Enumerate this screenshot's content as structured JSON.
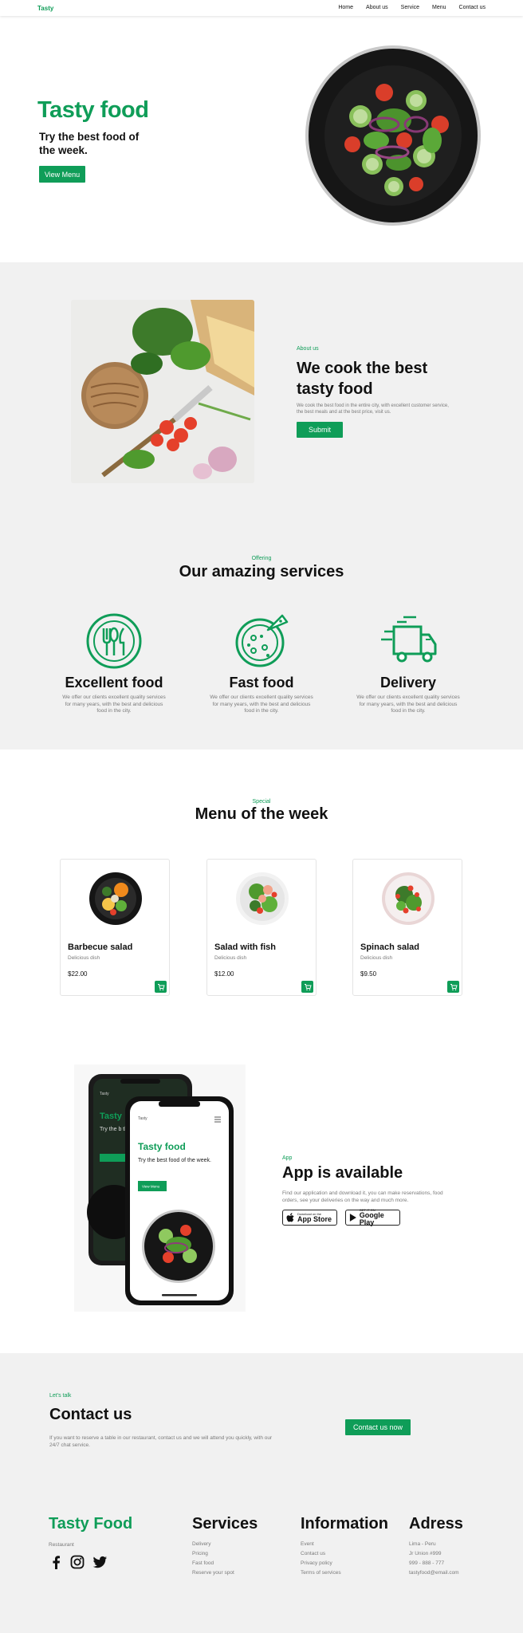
{
  "colors": {
    "accent": "#0f9d58",
    "band": "#f1f1f1",
    "text": "#111111",
    "muted": "#7a7a7a"
  },
  "nav": {
    "logo": "Tasty",
    "links": [
      "Home",
      "About us",
      "Service",
      "Menu",
      "Contact us"
    ]
  },
  "hero": {
    "title": "Tasty food",
    "subtitle": "Try the best food of the week.",
    "button": "View Menu"
  },
  "about": {
    "tag": "About us",
    "title": "We cook the best tasty food",
    "text": "We cook the best food in the entire city, with excellent customer service, the best meals and at the best price, visit us.",
    "button": "Submit"
  },
  "services": {
    "tag": "Offering",
    "title": "Our amazing services",
    "items": [
      {
        "icon": "cutlery-icon",
        "title": "Excellent food",
        "text": "We offer our clients excellent quality services for many years, with the best and delicious food in the city."
      },
      {
        "icon": "pizza-icon",
        "title": "Fast food",
        "text": "We offer our clients excellent quality services for many years, with the best and delicious food in the city."
      },
      {
        "icon": "delivery-truck-icon",
        "title": "Delivery",
        "text": "We offer our clients excellent quality services for many years, with the best and delicious food in the city."
      }
    ]
  },
  "menu": {
    "tag": "Special",
    "title": "Menu of the week",
    "items": [
      {
        "name": "Barbecue salad",
        "desc": "Delicious dish",
        "price": "$22.00"
      },
      {
        "name": "Salad with fish",
        "desc": "Delicious dish",
        "price": "$12.00"
      },
      {
        "name": "Spinach salad",
        "desc": "Delicious dish",
        "price": "$9.50"
      }
    ]
  },
  "app": {
    "tag": "App",
    "title": "App is available",
    "text": "Find our application and download it, you can make reservations, food orders, see your deliveries on the way and much more.",
    "appstore_small": "Download on the",
    "appstore_big": "App Store",
    "googleplay_small": "GET IT ON",
    "googleplay_big": "Google Play",
    "phone_logo": "Tasty",
    "phone_title": "Tasty food",
    "phone_sub": "Try the best food of the week.",
    "phone_button": "View Menu",
    "phone_back_title": "Tasty",
    "phone_back_sub": "Try the b the wee"
  },
  "contact": {
    "tag": "Let's talk",
    "title": "Contact us",
    "text": "If you want to reserve a table in our restaurant, contact us and we will attend you quickly, with our 24/7 chat service.",
    "button": "Contact us now"
  },
  "footer": {
    "brand": "Tasty Food",
    "brand_sub": "Restaurant",
    "social": [
      "facebook-icon",
      "instagram-icon",
      "twitter-icon"
    ],
    "services": {
      "title": "Services",
      "items": [
        "Delivery",
        "Pricing",
        "Fast food",
        "Reserve your spot"
      ]
    },
    "information": {
      "title": "Information",
      "items": [
        "Event",
        "Contact us",
        "Privacy policy",
        "Terms of services"
      ]
    },
    "address": {
      "title": "Adress",
      "items": [
        "Lima - Peru",
        "Jr Union #999",
        "999 - 888 - 777",
        "tastyfood@email.com"
      ]
    }
  }
}
